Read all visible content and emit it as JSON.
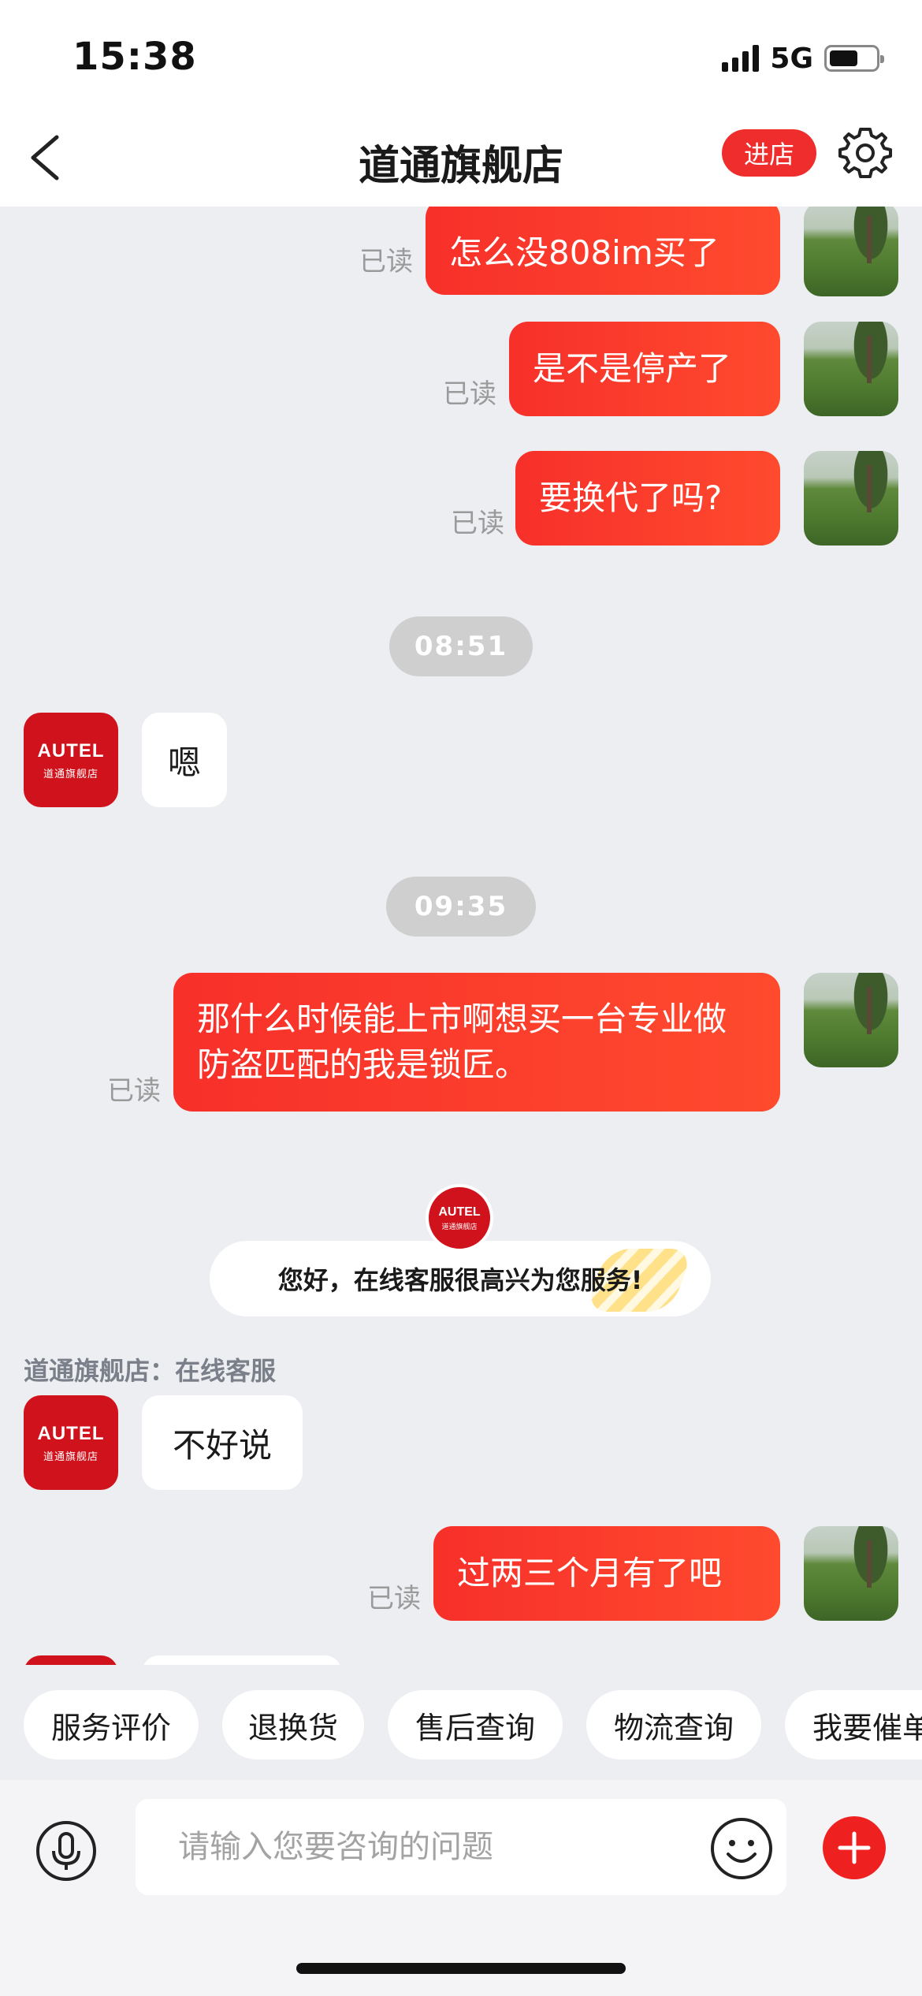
{
  "status_bar": {
    "time": "15:38",
    "network": "5G"
  },
  "header": {
    "title": "道通旗舰店",
    "enter_shop_label": "进店"
  },
  "brand": {
    "logo_text": "AUTEL",
    "logo_subtext": "道通旗舰店"
  },
  "messages": [
    {
      "text": "怎么没808im买了",
      "read": "已读"
    },
    {
      "text": "是不是停产了",
      "read": "已读"
    },
    {
      "text": "要换代了吗?",
      "read": "已读"
    },
    {
      "time": "08:51"
    },
    {
      "text": "嗯"
    },
    {
      "time": "09:35"
    },
    {
      "text": "那什么时候能上市啊想买一台专业做防盗匹配的我是锁匠。",
      "read": "已读"
    },
    {
      "text": "您好，在线客服很高兴为您服务!"
    },
    {
      "sender": "道通旗舰店：在线客服",
      "text": "不好说"
    },
    {
      "text": "过两三个月有了吧",
      "read": "已读"
    }
  ],
  "quick_actions": [
    "服务评价",
    "退换货",
    "售后查询",
    "物流查询",
    "我要催单"
  ],
  "input": {
    "placeholder": "请输入您要咨询的问题"
  },
  "colors": {
    "accent": "#ef2d2d",
    "brand": "#d0121c",
    "background": "#eceef1"
  }
}
